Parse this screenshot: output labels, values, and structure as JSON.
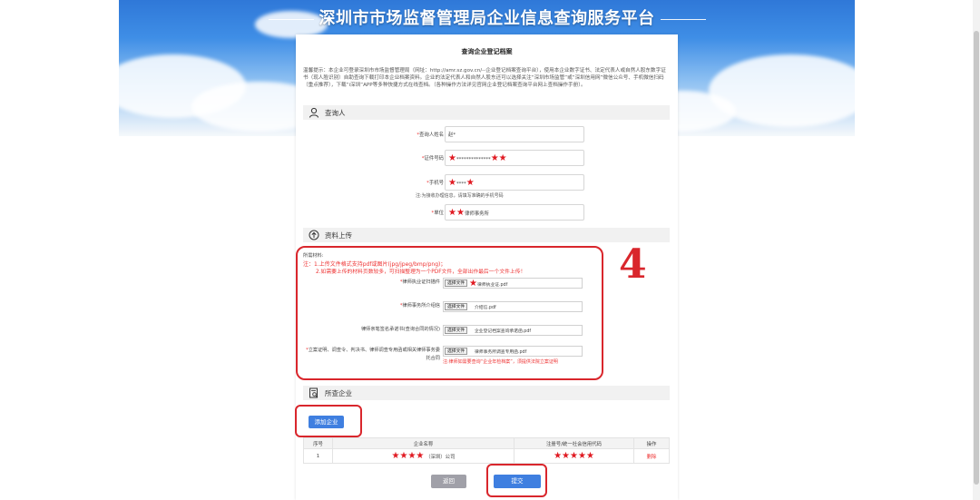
{
  "banner": {
    "title": "深圳市市场监督管理局企业信息查询服务平台"
  },
  "page": {
    "title": "查询企业登记档案",
    "notice": "温馨提示：本企业可登录深圳市市场监督管理局（网址：http://amr.sz.gov.cn/--企业登记档案查询平台），使用本企业数字证书、法定代表人或自然人股东数字证书（现人脸识别）自助查询下载打印本企业档案资料。企业的法定代表人和自然人股东还可以选择关注“深圳市场监管”或“深圳信用网”微信公众号、手机微信扫码（重点推荐），下载“i深圳”APP等多种快捷方式在线查档。（各种操作方法详见官网企业登记档案查询平台网上查档操作手册）。"
  },
  "sections": {
    "inquirer": "查询人",
    "upload": "资料上传",
    "companies": "所查企业"
  },
  "inquirer": {
    "name_label": "查询人姓名",
    "name_value": "赵*",
    "id_label": "证件号码",
    "id_value": "**************",
    "phone_label": "手机号",
    "phone_value": "****",
    "phone_hint": "注:为接收办理信息，请填写准确的手机号码",
    "unit_label": "单位",
    "unit_value": "律师事务所",
    "required_mark": "*"
  },
  "upload": {
    "materials_title": "所需材料:",
    "note_line1": "注：1.上传文件格式支持pdf或图片(jpg/jpeg/bmp/png)；",
    "note_line2": "2.如需要上传的材料页数较多，可扫描整理为一个PDF文件，全部出作最后一个文件上传！",
    "choose_label": "选择文件",
    "rows": [
      {
        "label": "律师执业证扫描件",
        "file": "律师执业证.pdf"
      },
      {
        "label": "律师事务所介绍信",
        "file": "介绍信.pdf"
      },
      {
        "label": "律师亲笔签名承诺书(查询合同的情况)",
        "file": "企业登记档案查询承诺函.pdf"
      },
      {
        "label": "立案证明、调查令、判决书、律师调查专用函或相关律师事务委托合同",
        "file": "律师事务所调查专用函.pdf"
      }
    ],
    "red_hint": "注:律师如需要查询“企业年检档案”，须提供法院立案证明",
    "annotation_number": "4"
  },
  "companies": {
    "add_button": "添加企业",
    "columns": [
      "序号",
      "企业名称",
      "注册号/统一社会信用代码",
      "操作"
    ],
    "rows": [
      {
        "index": "1",
        "name": "（深圳）公司",
        "code": "",
        "action": "删除"
      }
    ]
  },
  "actions": {
    "back": "返回",
    "submit": "提交"
  },
  "colors": {
    "annotation": "#d9262c",
    "primary_button": "#3f7fe0",
    "required": "#e33333"
  }
}
